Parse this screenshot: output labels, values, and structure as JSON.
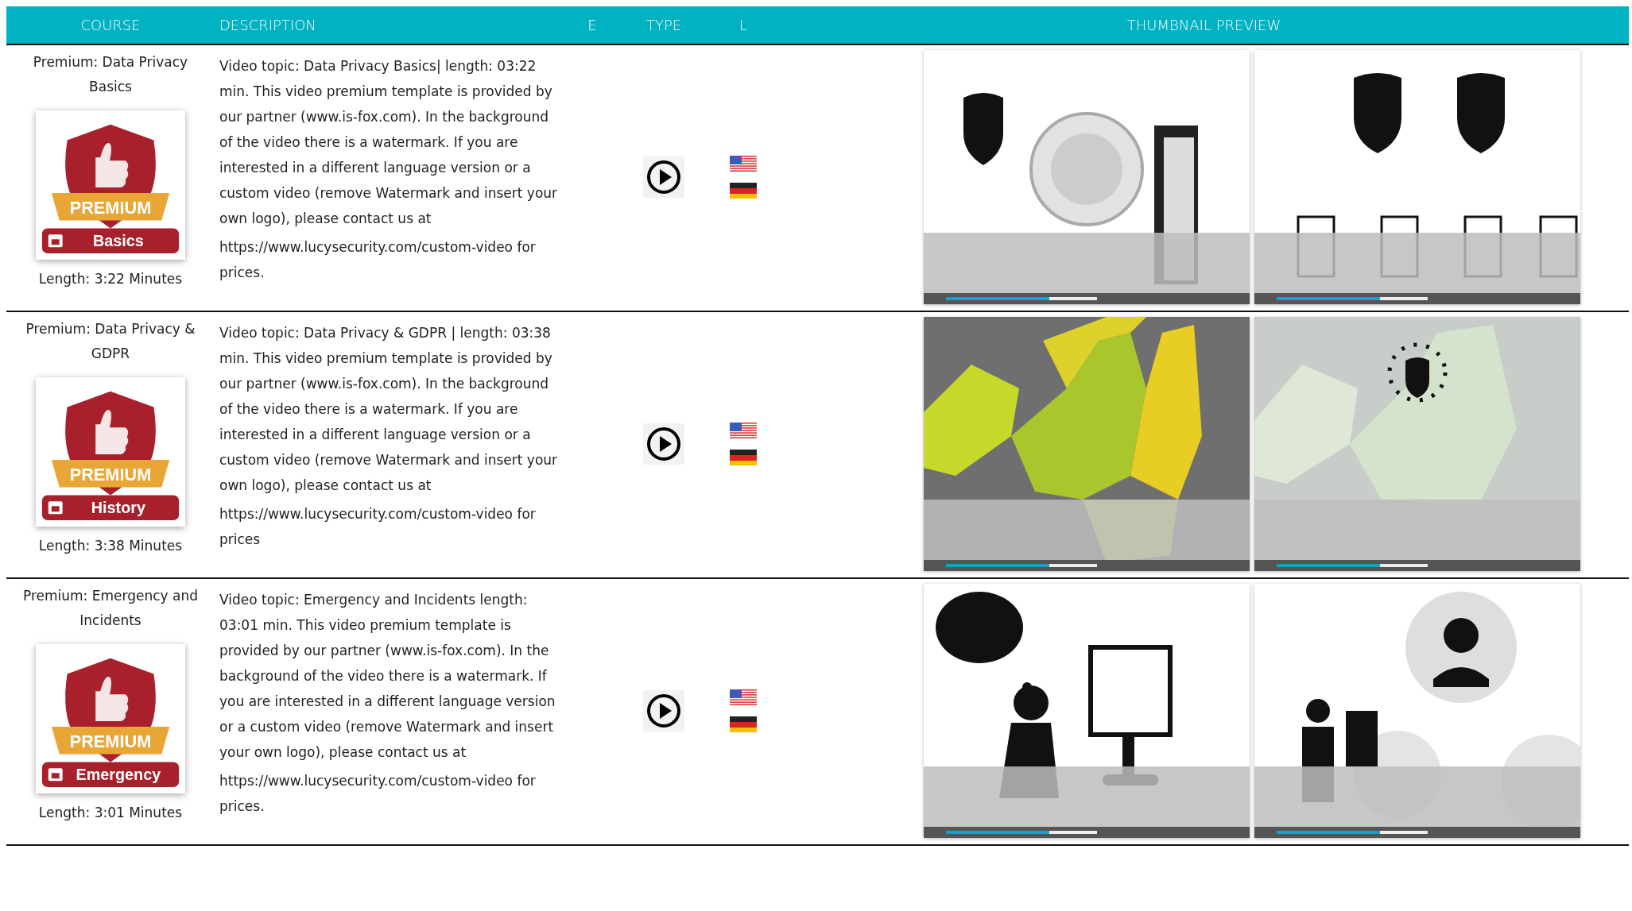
{
  "table": {
    "columns": [
      "COURSE",
      "DESCRIPTION",
      "E",
      "TYPE",
      "L",
      "THUMBNAIL PREVIEW"
    ],
    "rows": [
      {
        "title": "Premium: Data Privacy Basics",
        "badge": {
          "ribbon": "PREMIUM",
          "label": "Basics"
        },
        "length": "Length: 3:22 Minutes",
        "description": "Video topic: Data Privacy Basics| length: 03:22 min. This video premium template is provided by our partner (www.is-fox.com). In the background of the video there is a watermark. If you are interested in a different language version or a custom video (remove Watermark and insert your own logo), please contact us at",
        "pricing": "https://www.lucysecurity.com/custom-video for prices.",
        "languages": [
          {
            "kind": "us"
          },
          {
            "kind": "de"
          }
        ],
        "thumbnails": [
          {
            "kind": "picture"
          },
          {
            "kind": "picture"
          }
        ]
      },
      {
        "title": "Premium: Data Privacy & GDPR",
        "badge": {
          "ribbon": "PREMIUM",
          "label": "History"
        },
        "length": "Length: 3:38 Minutes",
        "description": "Video topic: Data Privacy & GDPR | length: 03:38 min. This video premium template is provided by our partner (www.is-fox.com). In the background of the video there is a watermark. If you are interested in a different language version or a custom video (remove Watermark and insert your own logo), please contact us at",
        "pricing": "https://www.lucysecurity.com/custom-video for prices",
        "languages": [
          {
            "kind": "us"
          },
          {
            "kind": "de"
          }
        ],
        "thumbnails": [
          {
            "kind": "picture"
          },
          {
            "kind": "picture"
          }
        ]
      },
      {
        "title": "Premium: Emergency and Incidents",
        "badge": {
          "ribbon": "PREMIUM",
          "label": "Emergency"
        },
        "length": "Length: 3:01 Minutes",
        "description": "Video topic: Emergency and Incidents length: 03:01 min. This video premium template is provided by our partner (www.is-fox.com). In the background of the video there is a watermark. If you are interested in a different language version or a custom video (remove Watermark and insert your own logo), please contact us at",
        "pricing": "https://www.lucysecurity.com/custom-video for prices.",
        "languages": [
          {
            "kind": "us"
          },
          {
            "kind": "de"
          }
        ],
        "thumbnails": [
          {
            "kind": "picture"
          },
          {
            "kind": "picture"
          }
        ]
      }
    ]
  }
}
